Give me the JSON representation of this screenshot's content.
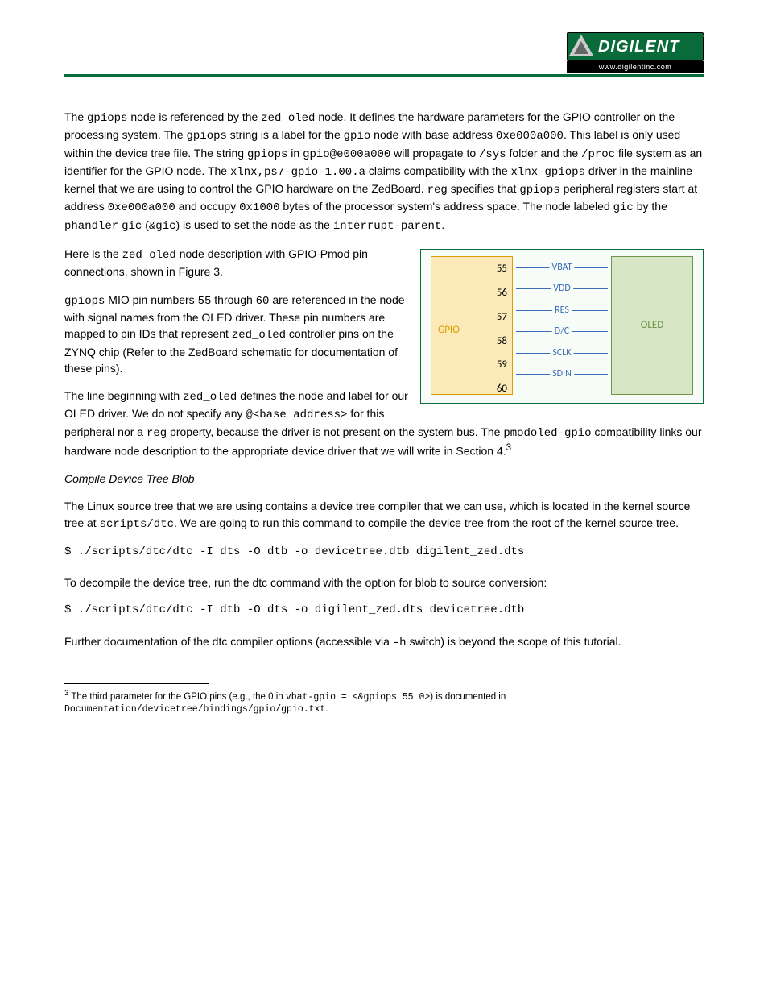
{
  "logo": {
    "brand": "DIGILENT",
    "url": "www.digilentinc.com",
    "reg": "®"
  },
  "p1a": "The ",
  "p1b": "gpiops",
  "p1c": " node is referenced by the ",
  "p1d": "zed_oled",
  "p1e": " node. It defines the hardware parameters for the GPIO controller on the processing system. The ",
  "p1f": "gpiops",
  "p1g": " string is a label for the ",
  "p1h": "gpio",
  "p1i": " node with base address ",
  "p1j": "0xe000a000",
  "p1k": ". This label is only used within the device tree file. The string ",
  "p1l": "gpiops",
  "p1m": " in ",
  "p1n": "gpio@e000a000",
  "p1o": " will propagate to ",
  "p1p": "/sys",
  "p1q": " folder and the ",
  "p1r": "/proc",
  "p1s": " file system as an identifier for the GPIO node. The ",
  "p1t": "xlnx,ps7-gpio-1.00.a",
  "p1u": " claims compatibility with the ",
  "p1v": "xlnx-gpiops",
  "p1w": " driver in the mainline kernel that we are using to control the GPIO hardware on the ZedBoard. ",
  "p1x": "reg",
  "p1y": " specifies that ",
  "p1z": "gpiops",
  "p1aa": " peripheral registers start at address ",
  "p1ab": "0xe000a000",
  "p1ac": " and occupy ",
  "p1ad": "0x1000",
  "p1ae": " bytes of the processor system's address space. The node labeled ",
  "p1af": "gic",
  "p1ag": " by the ",
  "p1ah": "phandler",
  "p1ai": " ",
  "p1aj": "gic",
  "p1ak": " (",
  "p1al": "&gic",
  "p1am": ") is used to set the node as the ",
  "p1an": "interrupt-parent",
  "p1ao": ".",
  "p2a": "Here is the ",
  "p2b": "zed_oled",
  "p2c": " node description with GPIO-Pmod pin connections, shown in Figure 3.",
  "diagram": {
    "gpio_label": "GPIO",
    "pins": [
      "55",
      "56",
      "57",
      "58",
      "59",
      "60"
    ],
    "wires": [
      "VBAT",
      "VDD",
      "RES",
      "D/C",
      "SCLK",
      "SDIN"
    ],
    "oled_label": "OLED"
  },
  "p3a": "gpiops",
  "p3b": " MIO pin numbers ",
  "p3c": "55",
  "p3d": " through ",
  "p3e": "60",
  "p3f": " are referenced in the node with signal names from the OLED driver. These pin numbers are mapped to pin IDs that represent ",
  "p3g": "zed_oled",
  "p3h": " controller pins on the ZYNQ chip (Refer to the ZedBoard schematic for documentation of these pins).",
  "p4a": "The line beginning with ",
  "p4b": "zed_oled",
  "p4c": " defines the node and label for our OLED driver. We do not specify any ",
  "p4d": "@<base address>",
  "p4e": " for this peripheral nor a ",
  "p4f": "reg",
  "p4g": " property, because the driver is not present on the system bus. The ",
  "p4h": "pmodoled-gpio",
  "p4i": " compatibility links our hardware node description to the appropriate device driver that we will write in Section 4.",
  "footnote_marker": "3",
  "h_compile": "Compile Device Tree Blob",
  "p5a": "The Linux source tree that we are using contains a device tree compiler that we can use, which is located in the kernel source tree at ",
  "p5b": "scripts/dtc",
  "p5c": ". We are going to run this command to compile the device tree from the root of the kernel source tree.",
  "cmd1": "$ ./scripts/dtc/dtc -I dts -O dtb -o devicetree.dtb digilent_zed.dts",
  "p6": "To decompile the device tree, run the dtc command with the option for blob to source conversion:",
  "cmd2": "$ ./scripts/dtc/dtc -I dtb -O dts -o digilent_zed.dts devicetree.dtb",
  "p7a": "Further documentation of the dtc compiler options (accessible via ",
  "p7b": "-h",
  "p7c": " switch) is beyond the scope of this tutorial.",
  "fn_a": "3",
  "fn_b": " The third parameter for the GPIO pins (e.g., the 0 in ",
  "fn_c": "vbat-gpio = <&gpiops 55 0>",
  "fn_d": ") is documented in ",
  "fn_e": "Documentation/devicetree/bindings/gpio/gpio.txt",
  "fn_f": "."
}
